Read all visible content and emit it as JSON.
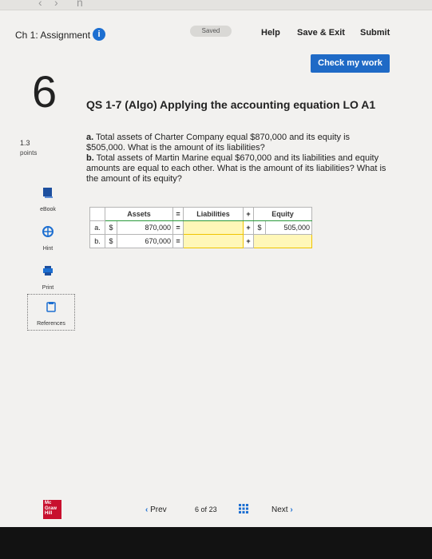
{
  "header": {
    "assignment_title": "Ch 1: Assignment",
    "info_icon": "i",
    "saved_status": "Saved",
    "help_label": "Help",
    "save_exit_label": "Save & Exit",
    "submit_label": "Submit",
    "check_label": "Check my work"
  },
  "question": {
    "number": "6",
    "points_value": "1.3",
    "points_label": "points",
    "title": "QS 1-7 (Algo) Applying the accounting equation LO A1",
    "part_a_label": "a.",
    "part_a_text": "Total assets of Charter Company equal $870,000 and its equity is $505,000. What is the amount of its liabilities?",
    "part_b_label": "b.",
    "part_b_text": "Total assets of Martin Marine equal $670,000 and its liabilities and equity amounts are equal to each other. What is the amount of its liabilities? What is the amount of its equity?"
  },
  "tools": {
    "ebook": "eBook",
    "hint": "Hint",
    "print": "Print",
    "references": "References"
  },
  "table": {
    "headers": {
      "assets": "Assets",
      "equals": "=",
      "liabilities": "Liabilities",
      "plus": "+",
      "equity": "Equity"
    },
    "rows": [
      {
        "label": "a.",
        "currency": "$",
        "assets": "870,000",
        "equals": "=",
        "liabilities": "",
        "plus": "+",
        "equity_currency": "$",
        "equity": "505,000"
      },
      {
        "label": "b.",
        "currency": "$",
        "assets": "670,000",
        "equals": "=",
        "liabilities": "",
        "plus": "+",
        "equity_currency": "",
        "equity": ""
      }
    ]
  },
  "footer": {
    "logo_text": "Mc Graw Hill",
    "logo_line1": "Mc",
    "logo_line2": "Graw",
    "logo_line3": "Hill",
    "prev_label": "Prev",
    "page_current": "6",
    "page_of": "of",
    "page_total": "23",
    "next_label": "Next"
  },
  "colors": {
    "accent_blue": "#1f6ac6",
    "brand_red": "#c8102e",
    "input_yellow": "#fff7b8"
  },
  "icons": [
    "info-icon",
    "book-icon",
    "hint-icon",
    "print-icon",
    "references-icon",
    "grid-icon",
    "chevron-left-icon",
    "chevron-right-icon"
  ]
}
